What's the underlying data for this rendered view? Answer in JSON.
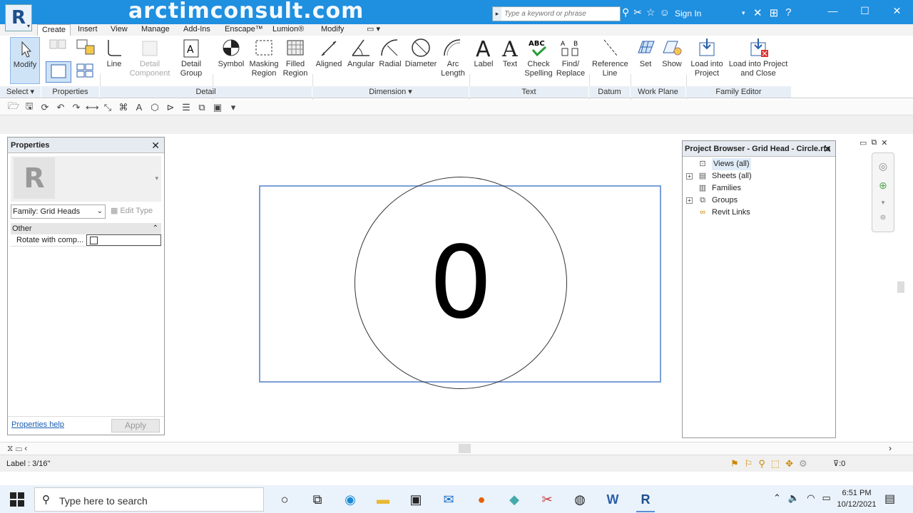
{
  "titlebar": {
    "watermark": "arctimconsult.com",
    "search_placeholder": "Type a keyword or phrase",
    "sign_in": "Sign In"
  },
  "ribbon_tabs": [
    "Create",
    "Insert",
    "View",
    "Manage",
    "Add-Ins",
    "Enscape™",
    "Lumion®",
    "Modify"
  ],
  "ribbon": {
    "modify": "Modify",
    "line": "Line",
    "detail_component": "Detail Component",
    "detail_group": "Detail Group",
    "symbol": "Symbol",
    "masking_region": "Masking Region",
    "filled_region": "Filled Region",
    "aligned": "Aligned",
    "angular": "Angular",
    "radial": "Radial",
    "diameter": "Diameter",
    "arc_length": "Arc Length",
    "label": "Label",
    "text": "Text",
    "check_spelling": "Check Spelling",
    "find_replace": "Find/ Replace",
    "reference_line": "Reference Line",
    "set": "Set",
    "show": "Show",
    "load_into_project": "Load into Project",
    "load_into_project_close": "Load into Project and Close"
  },
  "panels": {
    "select": "Select ▾",
    "properties": "Properties",
    "detail": "Detail",
    "dimension": "Dimension ▾",
    "text": "Text",
    "datum": "Datum",
    "work_plane": "Work Plane",
    "family_editor": "Family Editor"
  },
  "properties": {
    "title": "Properties",
    "family": "Family: Grid Heads",
    "edit_type": "Edit Type",
    "group": "Other",
    "param_name": "Rotate with comp...",
    "param_checked": false,
    "help": "Properties help",
    "apply": "Apply"
  },
  "canvas": {
    "label_value": "0"
  },
  "project_browser": {
    "title": "Project Browser - Grid Head - Circle.rfa",
    "items": [
      {
        "label": "Views (all)",
        "expandable": false
      },
      {
        "label": "Sheets (all)",
        "expandable": true
      },
      {
        "label": "Families",
        "expandable": false
      },
      {
        "label": "Groups",
        "expandable": true
      },
      {
        "label": "Revit Links",
        "expandable": false
      }
    ]
  },
  "status": {
    "text": "Label : 3/16\"",
    "filter_count": ":0"
  },
  "taskbar": {
    "search_placeholder": "Type here to search",
    "time": "6:51 PM",
    "date": "10/12/2021"
  }
}
